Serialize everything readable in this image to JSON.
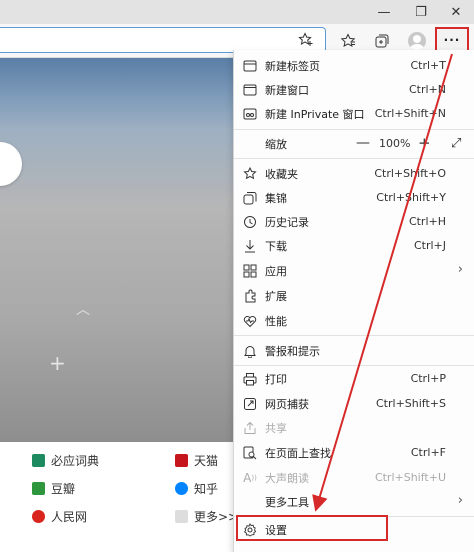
{
  "window_controls": {
    "minimize": "—",
    "restore": "❐",
    "close": "✕"
  },
  "toolbar": {
    "more_label": "···"
  },
  "new_tab_links": [
    {
      "label": "必应词典",
      "color": "#1d8a60"
    },
    {
      "label": "天猫",
      "color": "#c4161c"
    },
    {
      "label": "豆瓣",
      "color": "#2e963d"
    },
    {
      "label": "知乎",
      "color": "#0084ff"
    },
    {
      "label": "人民网",
      "color": "#d8241c"
    },
    {
      "label": "更多>>",
      "color": "#999999"
    }
  ],
  "menu": {
    "items": [
      {
        "label": "新建标签页",
        "shortcut": "Ctrl+T",
        "icon": "new-tab-icon"
      },
      {
        "label": "新建窗口",
        "shortcut": "Ctrl+N",
        "icon": "new-window-icon"
      },
      {
        "label": "新建 InPrivate 窗口",
        "shortcut": "Ctrl+Shift+N",
        "icon": "inprivate-icon"
      },
      {
        "label": "缩放",
        "shortcut": "",
        "icon": ""
      },
      {
        "label": "收藏夹",
        "shortcut": "Ctrl+Shift+O",
        "icon": "favorites-icon"
      },
      {
        "label": "集锦",
        "shortcut": "Ctrl+Shift+Y",
        "icon": "collections-icon"
      },
      {
        "label": "历史记录",
        "shortcut": "Ctrl+H",
        "icon": "history-icon"
      },
      {
        "label": "下载",
        "shortcut": "Ctrl+J",
        "icon": "download-icon"
      },
      {
        "label": "应用",
        "shortcut": "",
        "icon": "apps-icon"
      },
      {
        "label": "扩展",
        "shortcut": "",
        "icon": "extensions-icon"
      },
      {
        "label": "性能",
        "shortcut": "",
        "icon": "performance-icon"
      },
      {
        "label": "警报和提示",
        "shortcut": "",
        "icon": "alerts-icon"
      },
      {
        "label": "打印",
        "shortcut": "Ctrl+P",
        "icon": "print-icon"
      },
      {
        "label": "网页捕获",
        "shortcut": "Ctrl+Shift+S",
        "icon": "capture-icon"
      },
      {
        "label": "共享",
        "shortcut": "",
        "icon": "share-icon"
      },
      {
        "label": "在页面上查找",
        "shortcut": "Ctrl+F",
        "icon": "find-icon"
      },
      {
        "label": "大声朗读",
        "shortcut": "Ctrl+Shift+U",
        "icon": "read-aloud-icon"
      },
      {
        "label": "更多工具",
        "shortcut": "",
        "icon": ""
      },
      {
        "label": "设置",
        "shortcut": "",
        "icon": "settings-icon"
      }
    ],
    "zoom": {
      "minus": "—",
      "value": "100%",
      "plus": "+"
    }
  },
  "colors": {
    "highlight": "#d62a2a",
    "address_border": "#5b9ad5"
  }
}
